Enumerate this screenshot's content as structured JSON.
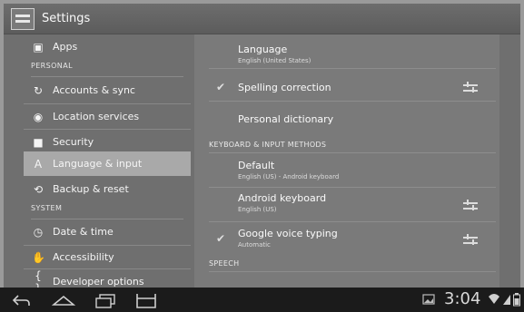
{
  "action_bar": {
    "title": "Settings"
  },
  "left_menu": {
    "apps": "Apps",
    "header_personal": "PERSONAL",
    "accounts": "Accounts & sync",
    "location": "Location services",
    "security": "Security",
    "language": "Language & input",
    "backup": "Backup & reset",
    "header_system": "SYSTEM",
    "datetime": "Date & time",
    "accessibility": "Accessibility",
    "developer": "Developer options"
  },
  "detail": {
    "language_title": "Language",
    "language_sub": "English (United States)",
    "spelling_title": "Spelling correction",
    "personal_dict_title": "Personal dictionary",
    "keyboard_header": "KEYBOARD & INPUT METHODS",
    "default_title": "Default",
    "default_sub": "English (US) - Android keyboard",
    "android_kb_title": "Android keyboard",
    "android_kb_sub": "English (US)",
    "voice_title": "Google voice typing",
    "voice_sub": "Automatic",
    "speech_header": "SPEECH"
  },
  "status": {
    "time": "3:04"
  },
  "icons": {
    "back": "back-icon",
    "home": "home-icon",
    "recent": "recent-apps-icon",
    "screenshot": "screenshot-icon",
    "wifi": "wifi-icon",
    "signal": "signal-icon",
    "battery": "battery-icon"
  }
}
